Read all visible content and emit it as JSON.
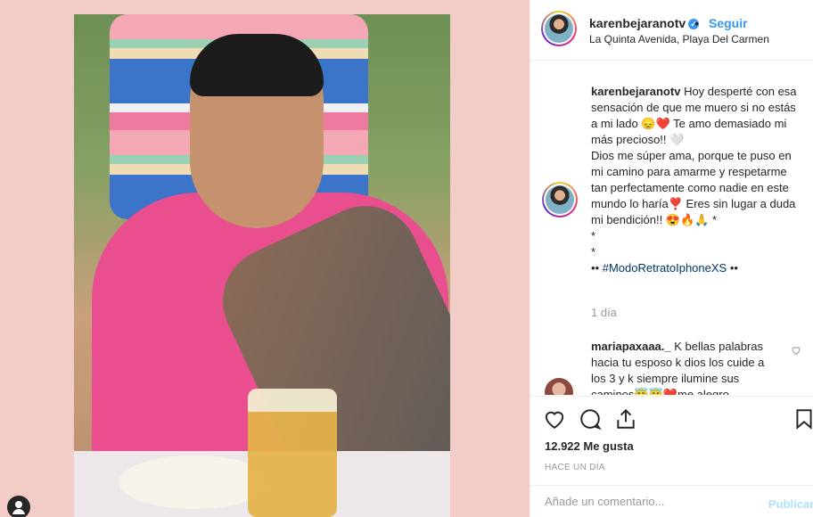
{
  "post": {
    "username": "karenbejaranotv",
    "follow_label": "Seguir",
    "dot": "•",
    "verified_mark": "✓",
    "location": "La Quinta Avenida, Playa Del Carmen"
  },
  "caption": {
    "username": "karenbejaranotv",
    "line1": "Hoy desperté con esa sensación de que me muero si no estás a mi lado",
    "emoji1": "😞❤️",
    "line2": "Te amo demasiado mi más precioso!! ",
    "emoji2": "🤍",
    "line3": "Dios me súper ama, porque te puso en mi camino para amarme y respetarme tan perfectamente como nadie en este mundo lo haría",
    "emoji3": "❣️",
    "line4": "Eres sin lugar a duda mi bendición!!",
    "emoji4": "😍🔥🙏",
    "line5": "*",
    "line6": "*",
    "line7": "*",
    "tag_prefix": "••",
    "hashtag": "#ModoRetratoIphoneXS",
    "tag_suffix": "••",
    "time_ago": "1 día"
  },
  "comment": {
    "username": "mariapaxaaa._",
    "text": "K bellas palabras hacia tu esposo k dios los cuide a los 3 y k siempre ilumine sus caminos",
    "emoji": "😇😇❤️",
    "text2": "me alegro"
  },
  "actions": {
    "likes": "12.922 Me gusta",
    "posted": "HACE UN DÍA"
  },
  "add_comment": {
    "placeholder": "Añade un comentario...",
    "publish_label": "Publicar"
  },
  "colors": {
    "background": "#f2ccc7",
    "link_blue": "#3897f0",
    "publish_disabled": "#b2dffc"
  },
  "icons": [
    "heart-icon",
    "comment-icon",
    "share-icon",
    "bookmark-icon",
    "verified-icon"
  ]
}
